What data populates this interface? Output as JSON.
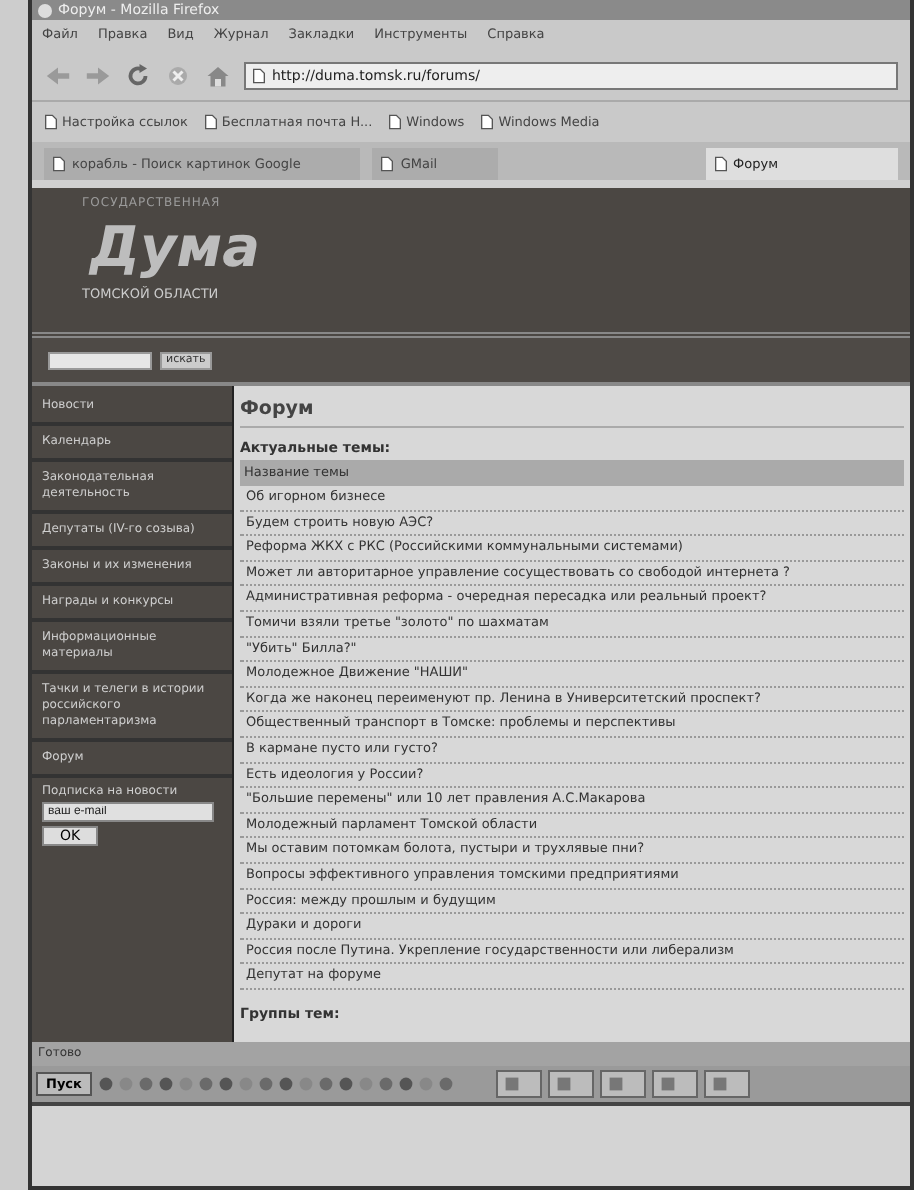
{
  "window": {
    "title": "Форум - Mozilla Firefox"
  },
  "menu": [
    "Файл",
    "Правка",
    "Вид",
    "Журнал",
    "Закладки",
    "Инструменты",
    "Справка"
  ],
  "address": {
    "value": "http://duma.tomsk.ru/forums/"
  },
  "bookmarks": [
    "Настройка ссылок",
    "Бесплатная почта H...",
    "Windows",
    "Windows Media"
  ],
  "tabs": [
    {
      "label": "корабль - Поиск картинок Google",
      "selected": false
    },
    {
      "label": "GMail",
      "selected": false
    },
    {
      "label": "Форум",
      "selected": true
    }
  ],
  "site": {
    "pretitle": "ГОСУДАРСТВЕННАЯ",
    "logo": "Дума",
    "subtitle": "ТОМСКОЙ ОБЛАСТИ",
    "search_button": "искать"
  },
  "sidebar": {
    "items": [
      "Новости",
      "Календарь",
      "Законодательная деятельность",
      "Депутаты (IV-го созыва)",
      "Законы и их изменения",
      "Награды и конкурсы",
      "Информационные материалы",
      "Тачки и телеги в истории российского парламентаризма",
      "Форум"
    ],
    "subscribe": {
      "label": "Подписка на новости",
      "placeholder": "ваш e-mail",
      "button": "OK"
    }
  },
  "main": {
    "title": "Форум",
    "section": "Актуальные темы:",
    "column": "Название темы",
    "topics": [
      "Об игорном бизнесе",
      "Будем строить новую АЭС?",
      "Реформа ЖКХ с РКС (Российскими коммунальными системами)",
      "Может ли авторитарное управление сосуществовать со свободой интернета ?",
      "Административная реформа - очередная пересадка или реальный проект?",
      "Томичи взяли третье \"золото\" по шахматам",
      "\"Убить\" Билла?\"",
      "Молодежное Движение \"НАШИ\"",
      "Когда же наконец переименуют пр. Ленина в Университетский проспект?",
      "Общественный транспорт в Томске: проблемы и перспективы",
      "В кармане пусто или густо?",
      "Есть идеология у России?",
      "\"Большие перемены\" или 10 лет правления А.С.Макарова",
      "Молодежный парламент Томской области",
      "Мы оставим потомкам болота, пустыри и трухлявые пни?",
      "Вопросы эффективного управления томскими предприятиями",
      "Россия: между прошлым и будущим",
      "Дураки и дороги",
      "Россия после Путина. Укрепление государственности или либерализм",
      "Депутат на форуме"
    ],
    "groups_heading": "Группы тем:"
  },
  "status_bar": "Готово",
  "taskbar": {
    "start": "Пуск"
  }
}
